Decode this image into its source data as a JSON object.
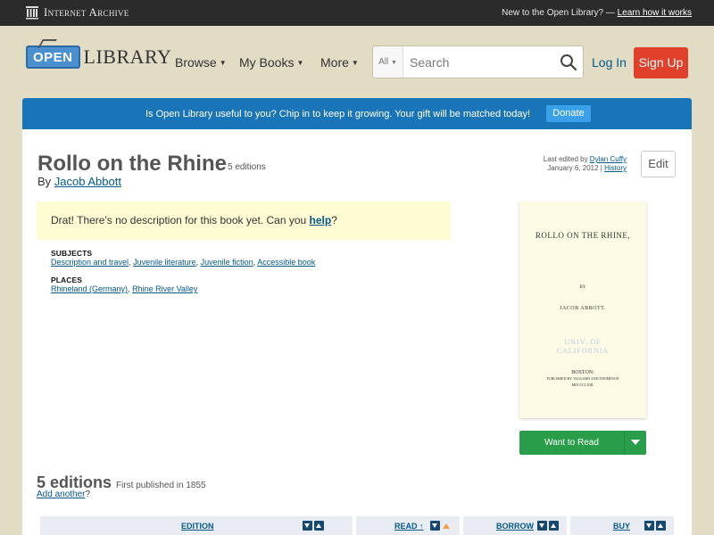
{
  "ia_bar": {
    "logo_text": "Internet Archive",
    "new_prompt": "New to the Open Library? — ",
    "learn_link": "Learn how it works"
  },
  "header": {
    "logo_open": "OPEN",
    "logo_library": "LIBRARY",
    "nav": {
      "browse": "Browse",
      "my_books": "My Books",
      "more": "More"
    },
    "search": {
      "category": "All",
      "placeholder": "Search"
    },
    "login": "Log In",
    "signup": "Sign Up"
  },
  "donate_banner": {
    "text": "Is Open Library useful to you? Chip in to keep it growing. Your gift will be matched today!",
    "button": "Donate"
  },
  "book": {
    "title": "Rollo on the Rhine",
    "editions_count": "5 editions",
    "by": "By",
    "author": "Jacob Abbott",
    "last_edited_prefix": "Last edited by",
    "last_edited_user": "Dylan Cuffy",
    "last_edited_date": "January 6, 2012 |",
    "history_link": "History",
    "edit_button": "Edit",
    "no_description_text": "Drat! There's no description for this book yet. Can you ",
    "help_link": "help",
    "no_description_end": "?",
    "subjects_label": "SUBJECTS",
    "subjects": [
      "Description and travel",
      "Juvenile literature",
      "Juvenile fiction",
      "Accessible book"
    ],
    "places_label": "PLACES",
    "places": [
      "Rhineland (Germany)",
      "Rhine River Valley"
    ],
    "cover": {
      "title": "ROLLO ON THE RHINE,",
      "by": "BY",
      "author": "JACOB ABBOTT.",
      "stamp_line1": "UNIV. OF",
      "stamp_line2": "CALIFORNIA",
      "city": "BOSTON:",
      "publisher": "PUBLISHED BY TAGGARD AND THOMPSON",
      "year": "MDCCCLXIII."
    },
    "want_to_read": "Want to Read"
  },
  "editions_section": {
    "heading": "5 editions",
    "first_published": "First published in 1855",
    "add_another": "Add another",
    "add_another_suffix": "?",
    "columns": {
      "edition": "EDITION",
      "read": "READ ↑",
      "borrow": "BORROW",
      "buy": "BUY"
    }
  }
}
